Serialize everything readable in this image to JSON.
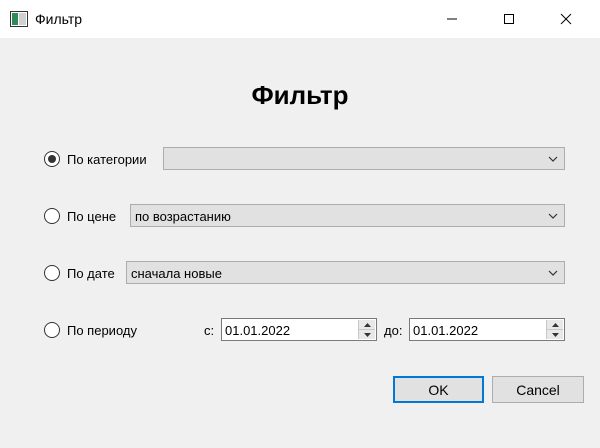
{
  "window": {
    "title": "Фильтр"
  },
  "heading": "Фильтр",
  "options": {
    "category": {
      "label": "По категории",
      "checked": true,
      "value": ""
    },
    "price": {
      "label": "По цене",
      "checked": false,
      "value": "по возрастанию"
    },
    "date": {
      "label": "По дате",
      "checked": false,
      "value": "сначала новые"
    },
    "period": {
      "label": "По периоду",
      "checked": false,
      "from_label": "с:",
      "from_value": "01.01.2022",
      "to_label": "до:",
      "to_value": "01.01.2022"
    }
  },
  "buttons": {
    "ok": "OK",
    "cancel": "Cancel"
  },
  "colors": {
    "accent": "#0078d7",
    "background": "#f0f0f0"
  }
}
